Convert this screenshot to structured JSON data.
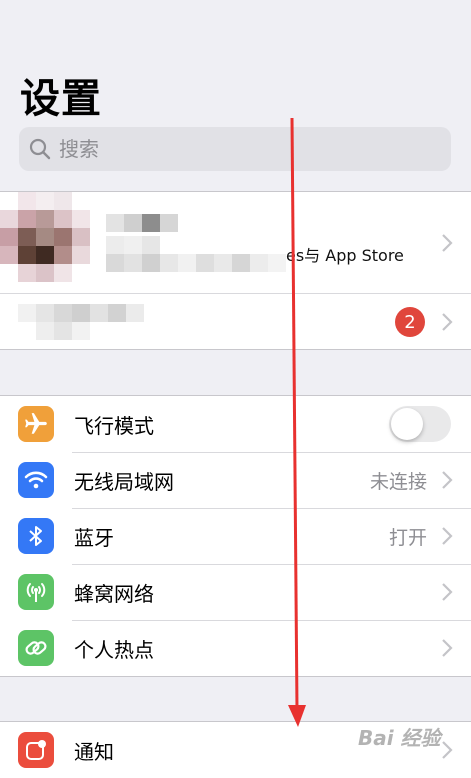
{
  "header": {
    "title": "设置"
  },
  "search": {
    "placeholder": "搜索",
    "icon": "search-icon"
  },
  "account": {
    "subtitle_tail": "es与 App Store",
    "alert_badge": "2"
  },
  "settings_group": {
    "airplane": {
      "label": "飞行模式",
      "icon": "airplane-icon",
      "color": "#f0a03a",
      "toggle_on": false
    },
    "wifi": {
      "label": "无线局域网",
      "value": "未连接",
      "icon": "wifi-icon",
      "color": "#3478f6"
    },
    "bluetooth": {
      "label": "蓝牙",
      "value": "打开",
      "icon": "bluetooth-icon",
      "color": "#3478f6"
    },
    "cellular": {
      "label": "蜂窝网络",
      "icon": "antenna-icon",
      "color": "#5dc466"
    },
    "hotspot": {
      "label": "个人热点",
      "icon": "hotspot-link-icon",
      "color": "#5dc466"
    }
  },
  "notifications_group": {
    "notifications": {
      "label": "通知",
      "icon": "notification-icon",
      "color": "#eb4d3d"
    }
  },
  "annotation": {
    "arrow_color": "#e8312f"
  },
  "watermark": {
    "text": "Bai  经验"
  }
}
